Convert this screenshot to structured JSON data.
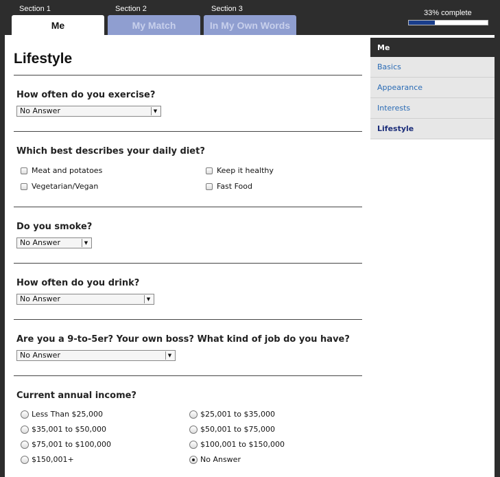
{
  "header": {
    "sections": [
      {
        "label": "Section 1",
        "tab": "Me"
      },
      {
        "label": "Section 2",
        "tab": "My Match"
      },
      {
        "label": "Section 3",
        "tab": "In My Own Words"
      }
    ],
    "progress_text": "33% complete",
    "progress_fraction": 0.33
  },
  "sidebar": {
    "title": "Me",
    "items": [
      {
        "label": "Basics"
      },
      {
        "label": "Appearance"
      },
      {
        "label": "Interests"
      },
      {
        "label": "Lifestyle"
      }
    ]
  },
  "main": {
    "title": "Lifestyle",
    "exercise": {
      "question": "How often do you exercise?",
      "value": "No Answer"
    },
    "diet": {
      "question": "Which best describes your daily diet?",
      "options": [
        "Meat and potatoes",
        "Keep it healthy",
        "Vegetarian/Vegan",
        "Fast Food"
      ]
    },
    "smoke": {
      "question": "Do you smoke?",
      "value": "No Answer"
    },
    "drink": {
      "question": "How often do you drink?",
      "value": "No Answer"
    },
    "job": {
      "question": "Are you a 9-to-5er? Your own boss? What kind of job do you have?",
      "value": "No Answer"
    },
    "income": {
      "question": "Current annual income?",
      "options": [
        "Less Than $25,000",
        "$25,001 to $35,000",
        "$35,001 to $50,000",
        "$50,001 to $75,000",
        "$75,001 to $100,000",
        "$100,001 to $150,000",
        "$150,001+",
        "No Answer"
      ],
      "selected": "No Answer"
    }
  }
}
